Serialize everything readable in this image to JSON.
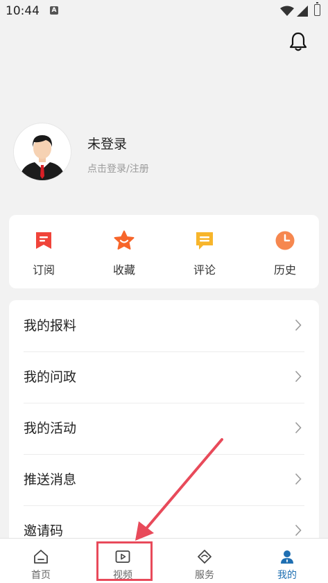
{
  "status_bar": {
    "time": "10:44",
    "notif_badge": "A",
    "icons": [
      "wifi-icon",
      "signal-icon",
      "battery-icon"
    ]
  },
  "header": {
    "icon": "bell-icon"
  },
  "profile": {
    "title": "未登录",
    "subtitle": "点击登录/注册",
    "avatar": "avatar-man-suit"
  },
  "quick_actions": [
    {
      "label": "订阅",
      "icon": "subscribe-icon",
      "color": "#f0443a"
    },
    {
      "label": "收藏",
      "icon": "star-icon",
      "color": "#f7662b"
    },
    {
      "label": "评论",
      "icon": "comment-icon",
      "color": "#f7b52b"
    },
    {
      "label": "历史",
      "icon": "clock-icon",
      "color": "#f6874f"
    }
  ],
  "menu": [
    {
      "label": "我的报料"
    },
    {
      "label": "我的问政"
    },
    {
      "label": "我的活动"
    },
    {
      "label": "推送消息"
    },
    {
      "label": "邀请码"
    }
  ],
  "tabs": [
    {
      "label": "首页",
      "icon": "home-icon",
      "active": false
    },
    {
      "label": "视频",
      "icon": "video-icon",
      "active": false
    },
    {
      "label": "服务",
      "icon": "service-icon",
      "active": false
    },
    {
      "label": "我的",
      "icon": "profile-icon",
      "active": true
    }
  ],
  "colors": {
    "accent": "#1f6fb2",
    "highlight": "#e84a5a"
  }
}
